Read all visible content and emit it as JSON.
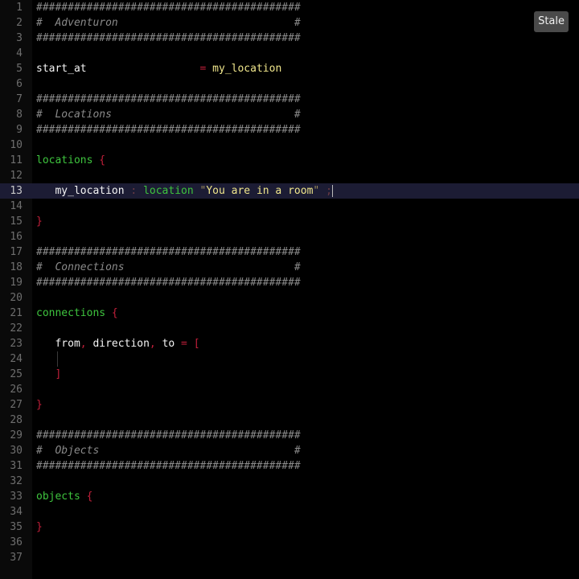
{
  "status": {
    "badge": "Stale"
  },
  "editor": {
    "active_line": 13,
    "lines": [
      {
        "n": "1",
        "tokens": [
          {
            "t": "##########################################",
            "c": "comment"
          }
        ]
      },
      {
        "n": "2",
        "tokens": [
          {
            "t": "#  Adventuron                            #",
            "c": "comment"
          }
        ]
      },
      {
        "n": "3",
        "tokens": [
          {
            "t": "##########################################",
            "c": "comment"
          }
        ]
      },
      {
        "n": "4",
        "tokens": []
      },
      {
        "n": "5",
        "tokens": [
          {
            "t": "start_at",
            "c": "id"
          },
          {
            "t": "                  ",
            "c": "id"
          },
          {
            "t": "=",
            "c": "punc"
          },
          {
            "t": " ",
            "c": "id"
          },
          {
            "t": "my_location",
            "c": "str"
          }
        ]
      },
      {
        "n": "6",
        "tokens": []
      },
      {
        "n": "7",
        "tokens": [
          {
            "t": "##########################################",
            "c": "comment"
          }
        ]
      },
      {
        "n": "8",
        "tokens": [
          {
            "t": "#  Locations                             #",
            "c": "comment"
          }
        ]
      },
      {
        "n": "9",
        "tokens": [
          {
            "t": "##########################################",
            "c": "comment"
          }
        ]
      },
      {
        "n": "10",
        "tokens": []
      },
      {
        "n": "11",
        "tokens": [
          {
            "t": "locations",
            "c": "kw"
          },
          {
            "t": " ",
            "c": "id"
          },
          {
            "t": "{",
            "c": "punc"
          }
        ]
      },
      {
        "n": "12",
        "tokens": []
      },
      {
        "n": "13",
        "tokens": [
          {
            "t": "   ",
            "c": "id"
          },
          {
            "t": "my_location",
            "c": "id"
          },
          {
            "t": " ",
            "c": "id"
          },
          {
            "t": ":",
            "c": "dim"
          },
          {
            "t": " ",
            "c": "id"
          },
          {
            "t": "location",
            "c": "kw"
          },
          {
            "t": " ",
            "c": "id"
          },
          {
            "t": "\"",
            "c": "quote"
          },
          {
            "t": "You are in a room",
            "c": "str"
          },
          {
            "t": "\"",
            "c": "quote"
          },
          {
            "t": " ",
            "c": "id"
          },
          {
            "t": ";",
            "c": "dim"
          },
          {
            "t": "",
            "c": "caret"
          }
        ]
      },
      {
        "n": "14",
        "tokens": []
      },
      {
        "n": "15",
        "tokens": [
          {
            "t": "}",
            "c": "punc"
          }
        ]
      },
      {
        "n": "16",
        "tokens": []
      },
      {
        "n": "17",
        "tokens": [
          {
            "t": "##########################################",
            "c": "comment"
          }
        ]
      },
      {
        "n": "18",
        "tokens": [
          {
            "t": "#  Connections                           #",
            "c": "comment"
          }
        ]
      },
      {
        "n": "19",
        "tokens": [
          {
            "t": "##########################################",
            "c": "comment"
          }
        ]
      },
      {
        "n": "20",
        "tokens": []
      },
      {
        "n": "21",
        "tokens": [
          {
            "t": "connections",
            "c": "kw"
          },
          {
            "t": " ",
            "c": "id"
          },
          {
            "t": "{",
            "c": "punc"
          }
        ]
      },
      {
        "n": "22",
        "tokens": []
      },
      {
        "n": "23",
        "tokens": [
          {
            "t": "   ",
            "c": "id"
          },
          {
            "t": "from",
            "c": "id"
          },
          {
            "t": ",",
            "c": "punc"
          },
          {
            "t": " ",
            "c": "id"
          },
          {
            "t": "direction",
            "c": "id"
          },
          {
            "t": ",",
            "c": "punc"
          },
          {
            "t": " ",
            "c": "id"
          },
          {
            "t": "to",
            "c": "id"
          },
          {
            "t": " ",
            "c": "id"
          },
          {
            "t": "=",
            "c": "punc"
          },
          {
            "t": " ",
            "c": "id"
          },
          {
            "t": "[",
            "c": "punc"
          }
        ]
      },
      {
        "n": "24",
        "tokens": [],
        "guide": true
      },
      {
        "n": "25",
        "tokens": [
          {
            "t": "   ",
            "c": "id"
          },
          {
            "t": "]",
            "c": "punc"
          }
        ]
      },
      {
        "n": "26",
        "tokens": []
      },
      {
        "n": "27",
        "tokens": [
          {
            "t": "}",
            "c": "punc"
          }
        ]
      },
      {
        "n": "28",
        "tokens": []
      },
      {
        "n": "29",
        "tokens": [
          {
            "t": "##########################################",
            "c": "comment"
          }
        ]
      },
      {
        "n": "30",
        "tokens": [
          {
            "t": "#  Objects                               #",
            "c": "comment"
          }
        ]
      },
      {
        "n": "31",
        "tokens": [
          {
            "t": "##########################################",
            "c": "comment"
          }
        ]
      },
      {
        "n": "32",
        "tokens": []
      },
      {
        "n": "33",
        "tokens": [
          {
            "t": "objects",
            "c": "kw"
          },
          {
            "t": " ",
            "c": "id"
          },
          {
            "t": "{",
            "c": "punc"
          }
        ]
      },
      {
        "n": "34",
        "tokens": []
      },
      {
        "n": "35",
        "tokens": [
          {
            "t": "}",
            "c": "punc"
          }
        ]
      },
      {
        "n": "36",
        "tokens": []
      },
      {
        "n": "37",
        "tokens": []
      }
    ]
  }
}
